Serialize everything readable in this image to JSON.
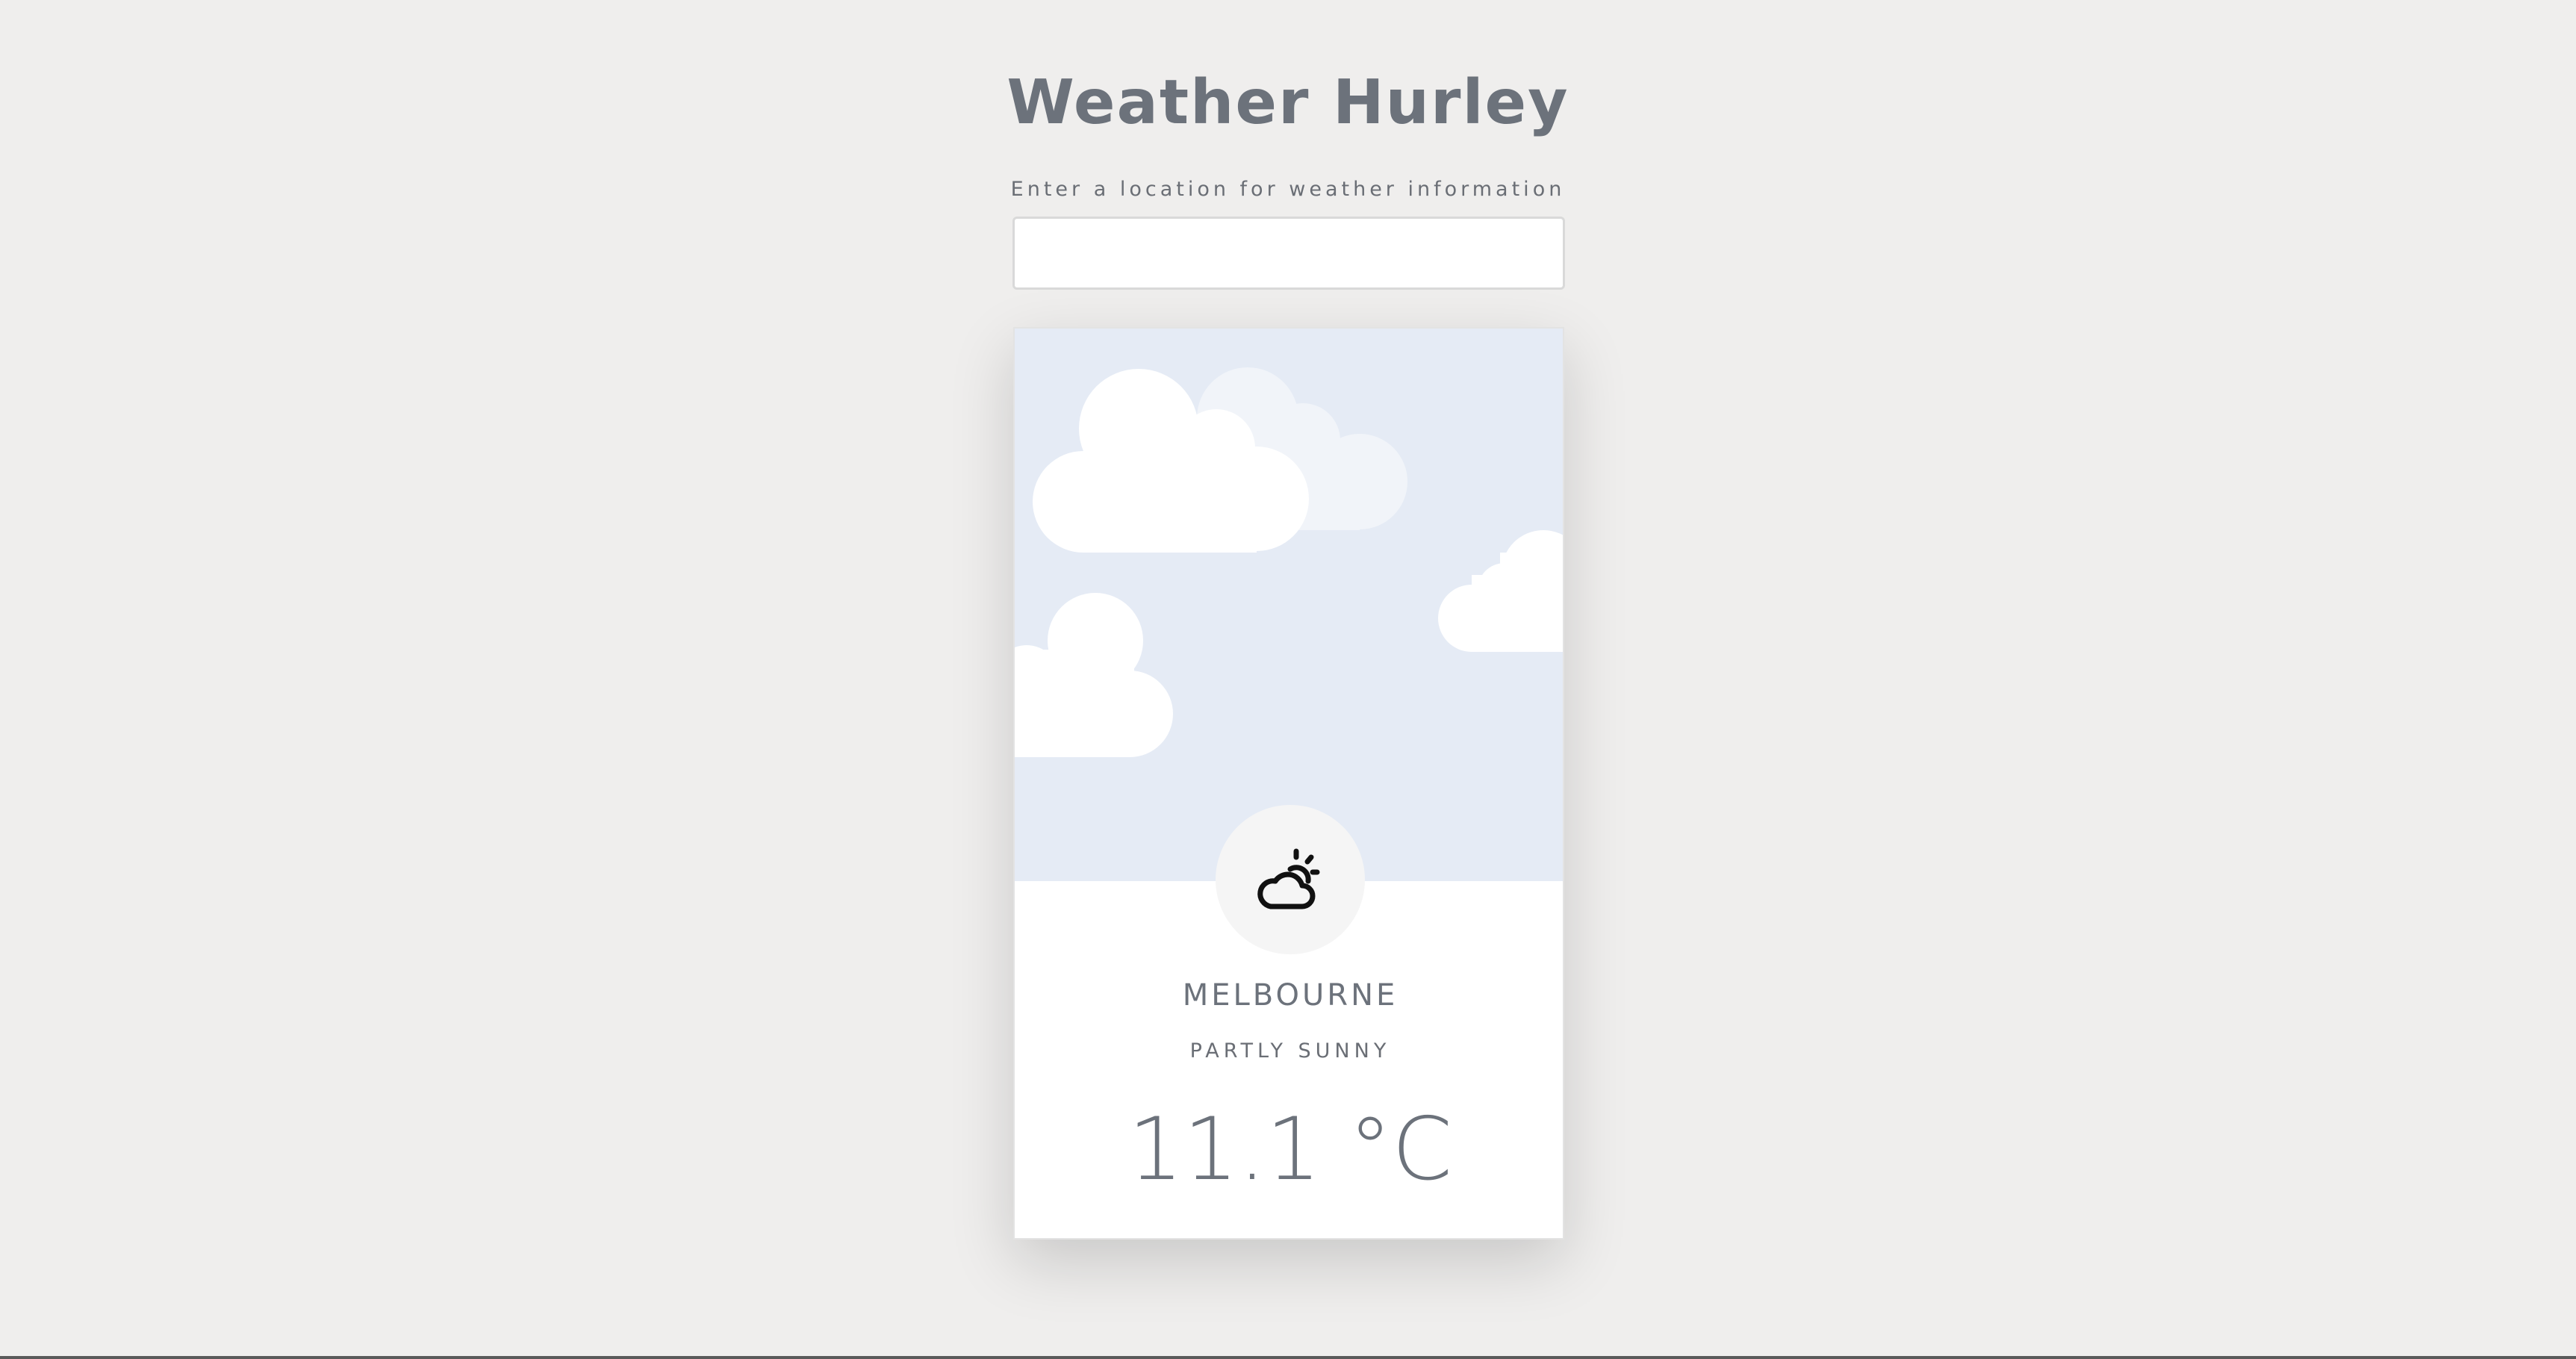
{
  "app": {
    "title": "Weather Hurley"
  },
  "search": {
    "label": "Enter a location for weather information",
    "value": "",
    "placeholder": ""
  },
  "weather": {
    "city": "MELBOURNE",
    "condition": "PARTLY SUNNY",
    "temperature": "11.1 °C",
    "icon": "partly-sunny-icon"
  },
  "colors": {
    "background": "#efeeed",
    "sky": "#e5ebf5",
    "text": "#6c727b"
  }
}
